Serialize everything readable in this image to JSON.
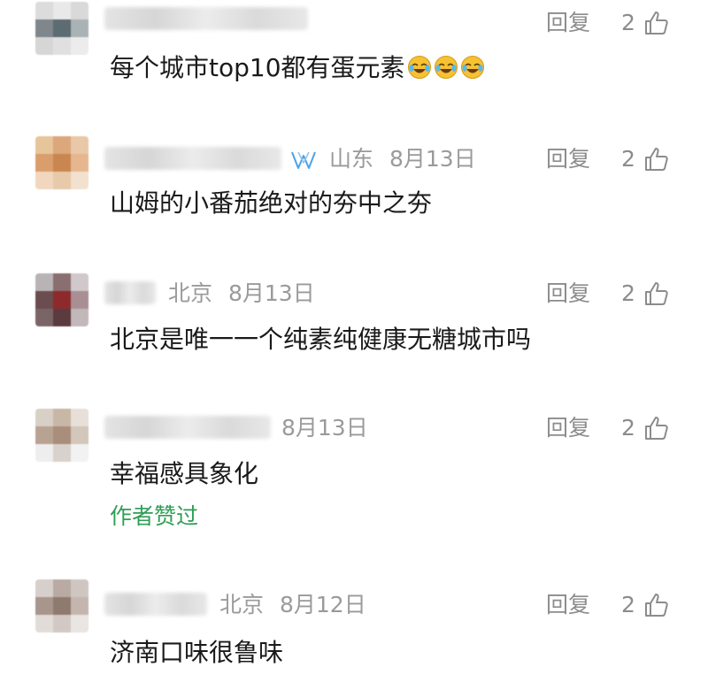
{
  "comments": [
    {
      "avatar_colors": [
        "#dcdcdc",
        "#e9e9e9",
        "#d9d9d9",
        "#7f878c",
        "#5d6b73",
        "#a9b3b6",
        "#d6d6d6",
        "#e0e0e0",
        "#ececec"
      ],
      "location": "",
      "date": "",
      "reply": "回复",
      "likes": "2",
      "text": "每个城市top10都有蛋元素",
      "emojis": [
        "laugh-cry-emoji",
        "laugh-cry-emoji",
        "laugh-cry-emoji"
      ],
      "author_liked": ""
    },
    {
      "avatar_colors": [
        "#e7c59a",
        "#dca77a",
        "#e9c8a7",
        "#d99e6b",
        "#c98650",
        "#e6b78f",
        "#f0d7be",
        "#e8c9a9",
        "#f3e1cf"
      ],
      "location": "山东",
      "date": "8月13日",
      "reply": "回复",
      "likes": "2",
      "text": "山姆的小番茄绝对的夯中之夯",
      "emojis": [],
      "author_liked": "",
      "badge": "verified-badge-icon"
    },
    {
      "avatar_colors": [
        "#b9b3b6",
        "#8a6f70",
        "#d0c8cb",
        "#6b4d4f",
        "#8f2a2c",
        "#a98f93",
        "#7a6466",
        "#5b3b3d",
        "#c2b7b9"
      ],
      "location": "北京",
      "date": "8月13日",
      "reply": "回复",
      "likes": "2",
      "text": "北京是唯一一个纯素纯健康无糖城市吗",
      "emojis": [],
      "author_liked": ""
    },
    {
      "avatar_colors": [
        "#d8cfc6",
        "#c9b7a6",
        "#e7dfd8",
        "#b8a393",
        "#a88e7b",
        "#d3c6bb",
        "#eeeeee",
        "#d9d2cc",
        "#f2f2f2"
      ],
      "location": "",
      "date": "8月13日",
      "reply": "回复",
      "likes": "2",
      "text": "幸福感具象化",
      "emojis": [],
      "author_liked": "作者赞过"
    },
    {
      "avatar_colors": [
        "#d6cfcc",
        "#b9aaa3",
        "#cfc6c2",
        "#a8958b",
        "#8f7a70",
        "#c4b6af",
        "#e2dcd9",
        "#d2c9c5",
        "#e9e5e3"
      ],
      "location": "北京",
      "date": "8月12日",
      "reply": "回复",
      "likes": "2",
      "text": "济南口味很鲁味",
      "emojis": [],
      "author_liked": ""
    }
  ]
}
